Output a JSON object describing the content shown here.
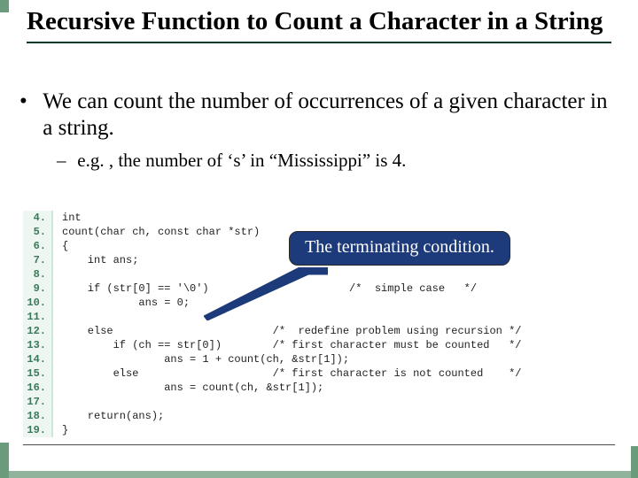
{
  "title": "Recursive Function to Count a Character in a String",
  "bullets": {
    "b1": "We can count the number of occurrences of a given character in a string.",
    "b2": "e.g. , the number of ‘s’ in “Mississippi” is 4."
  },
  "callout": "The terminating condition.",
  "code": {
    "lines": [
      {
        "n": "4.",
        "t": "int"
      },
      {
        "n": "5.",
        "t": "count(char ch, const char *str)"
      },
      {
        "n": "6.",
        "t": "{"
      },
      {
        "n": "7.",
        "t": "    int ans;"
      },
      {
        "n": "8.",
        "t": ""
      },
      {
        "n": "9.",
        "t": "    if (str[0] == '\\0')                      /*  simple case   */"
      },
      {
        "n": "10.",
        "t": "            ans = 0;"
      },
      {
        "n": "11.",
        "t": ""
      },
      {
        "n": "12.",
        "t": "    else                         /*  redefine problem using recursion */"
      },
      {
        "n": "13.",
        "t": "        if (ch == str[0])        /* first character must be counted   */"
      },
      {
        "n": "14.",
        "t": "                ans = 1 + count(ch, &str[1]);"
      },
      {
        "n": "15.",
        "t": "        else                     /* first character is not counted    */"
      },
      {
        "n": "16.",
        "t": "                ans = count(ch, &str[1]);"
      },
      {
        "n": "17.",
        "t": ""
      },
      {
        "n": "18.",
        "t": "    return(ans);"
      },
      {
        "n": "19.",
        "t": "}"
      }
    ]
  }
}
